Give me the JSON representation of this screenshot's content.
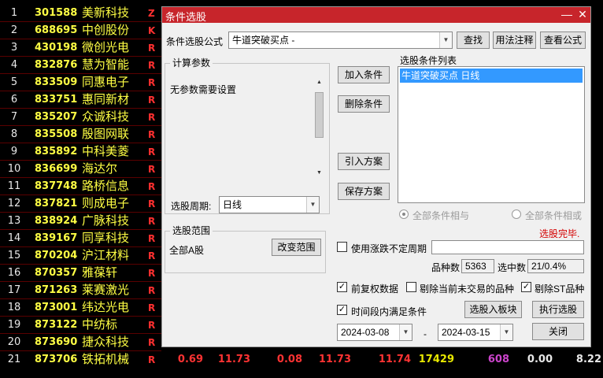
{
  "table": {
    "rows": [
      {
        "idx": "1",
        "code": "301588",
        "name": "美新科技",
        "flag": "Z"
      },
      {
        "idx": "2",
        "code": "688695",
        "name": "中创股份",
        "flag": "K"
      },
      {
        "idx": "3",
        "code": "430198",
        "name": "微创光电",
        "flag": "R"
      },
      {
        "idx": "4",
        "code": "832876",
        "name": "慧为智能",
        "flag": "R"
      },
      {
        "idx": "5",
        "code": "833509",
        "name": "同惠电子",
        "flag": "R"
      },
      {
        "idx": "6",
        "code": "833751",
        "name": "惠同新材",
        "flag": "R"
      },
      {
        "idx": "7",
        "code": "835207",
        "name": "众诚科技",
        "flag": "R"
      },
      {
        "idx": "8",
        "code": "835508",
        "name": "殷图网联",
        "flag": "R"
      },
      {
        "idx": "9",
        "code": "835892",
        "name": "中科美菱",
        "flag": "R"
      },
      {
        "idx": "10",
        "code": "836699",
        "name": "海达尔",
        "flag": "R"
      },
      {
        "idx": "11",
        "code": "837748",
        "name": "路桥信息",
        "flag": "R"
      },
      {
        "idx": "12",
        "code": "837821",
        "name": "则成电子",
        "flag": "R"
      },
      {
        "idx": "13",
        "code": "838924",
        "name": "广脉科技",
        "flag": "R"
      },
      {
        "idx": "14",
        "code": "839167",
        "name": "同享科技",
        "flag": "R"
      },
      {
        "idx": "15",
        "code": "870204",
        "name": "沪江材料",
        "flag": "R"
      },
      {
        "idx": "16",
        "code": "870357",
        "name": "雅葆轩",
        "flag": "R"
      },
      {
        "idx": "17",
        "code": "871263",
        "name": "莱赛激光",
        "flag": "R"
      },
      {
        "idx": "18",
        "code": "873001",
        "name": "纬达光电",
        "flag": "R"
      },
      {
        "idx": "19",
        "code": "873122",
        "name": "中纺标",
        "flag": "R"
      },
      {
        "idx": "20",
        "code": "873690",
        "name": "捷众科技",
        "flag": "R"
      },
      {
        "idx": "21",
        "code": "873706",
        "name": "铁拓机械",
        "flag": "R"
      }
    ],
    "last_row_values": {
      "v1": "0.69",
      "v2": "11.73",
      "v3": "0.08",
      "v4": "11.73",
      "v5": "11.74",
      "v6": "17429",
      "v7": "608",
      "v8": "0.00",
      "v9": "8.22"
    },
    "colors": {
      "code": "#ffff44",
      "flag": "#ff3030",
      "up": "#ff3333",
      "volume": "#e8e800",
      "amount": "#cc44cc",
      "neutral": "#e8e8e8"
    }
  },
  "dialog": {
    "title": "条件选股",
    "formula_label": "条件选股公式",
    "formula_value": "牛道突破买点 -",
    "find_button": "查找",
    "usage_button": "用法注释",
    "view_formula_button": "查看公式",
    "params_group": "计算参数",
    "params_text": "无参数需要设置",
    "period_label": "选股周期:",
    "period_value": "日线",
    "add_condition_button": "加入条件",
    "remove_condition_button": "删除条件",
    "import_plan_button": "引入方案",
    "save_plan_button": "保存方案",
    "condition_list_label": "选股条件列表",
    "condition_items": [
      "牛道突破买点  日线"
    ],
    "all_and_label": "全部条件相与",
    "all_or_label": "全部条件相或",
    "status_text": "选股完毕.",
    "range_group": "选股范围",
    "range_value": "全部A股",
    "change_range_button": "改变范围",
    "use_period_label": "使用涨跌不定周期",
    "total_label": "品种数",
    "total_value": "5363",
    "selected_label": "选中数",
    "selected_value": "21/0.4%",
    "forward_adjust_label": "前复权数据",
    "exclude_untraded_label": "剔除当前未交易的品种",
    "exclude_st_label": "剔除ST品种",
    "time_range_label": "时间段内满足条件",
    "add_to_block_button": "选股入板块",
    "run_button": "执行选股",
    "close_button": "关闭",
    "date_from": "2024-03-08",
    "date_to": "2024-03-15",
    "date_sep": "-",
    "accent": "#c7252b",
    "selection_bg": "#3399ff"
  }
}
